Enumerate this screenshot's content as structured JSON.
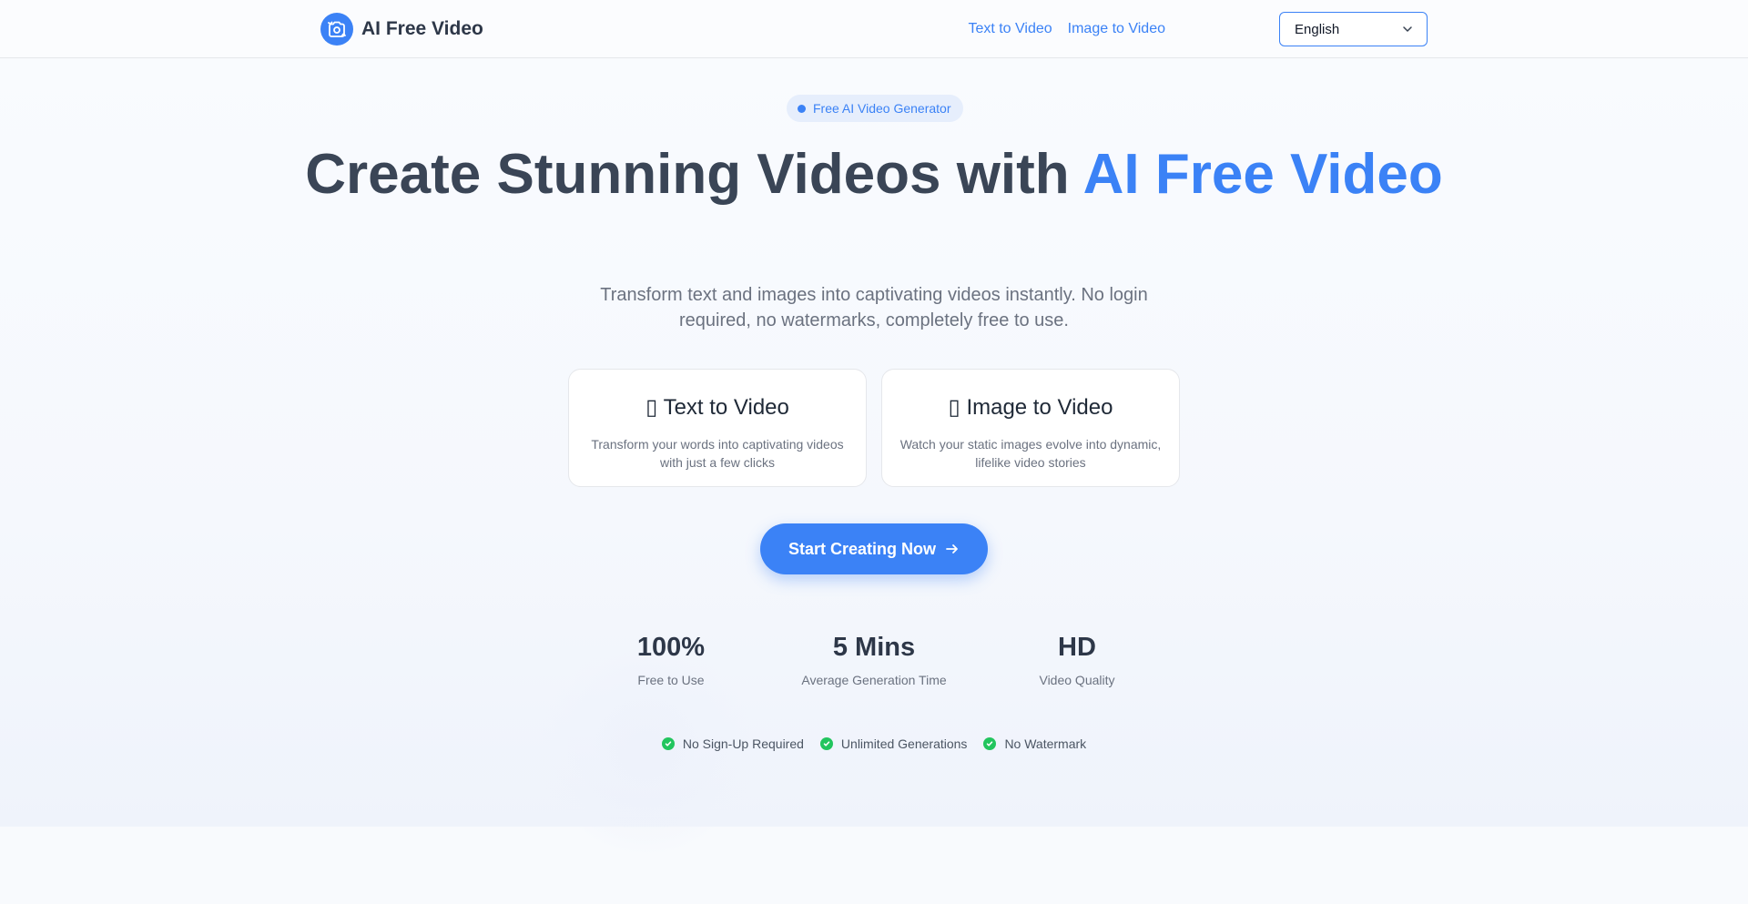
{
  "header": {
    "brand": "AI Free Video",
    "logo_icon": "camera-flip-icon",
    "nav": [
      {
        "label": "Text to Video"
      },
      {
        "label": "Image to Video"
      }
    ],
    "language": {
      "selected": "English"
    }
  },
  "hero": {
    "badge": "Free AI Video Generator",
    "headline_dark": "Create Stunning Videos with ",
    "headline_blue": "AI Free Video",
    "subtitle": "Transform text and images into captivating videos instantly. No login required, no watermarks, completely free to use.",
    "cards": [
      {
        "glyph": "▯",
        "title": "Text to Video",
        "description": "Transform your words into captivating videos with just a few clicks"
      },
      {
        "glyph": "▯",
        "title": "Image to Video",
        "description": "Watch your static images evolve into dynamic, lifelike video stories"
      }
    ],
    "cta_label": "Start Creating Now",
    "stats": [
      {
        "value": "100%",
        "label": "Free to Use"
      },
      {
        "value": "5 Mins",
        "label": "Average Generation Time"
      },
      {
        "value": "HD",
        "label": "Video Quality"
      }
    ],
    "features": [
      {
        "label": "No Sign-Up Required"
      },
      {
        "label": "Unlimited Generations"
      },
      {
        "label": "No Watermark"
      }
    ]
  },
  "colors": {
    "accent": "#3b82f6",
    "heading": "#3a4556",
    "success": "#22c55e"
  }
}
